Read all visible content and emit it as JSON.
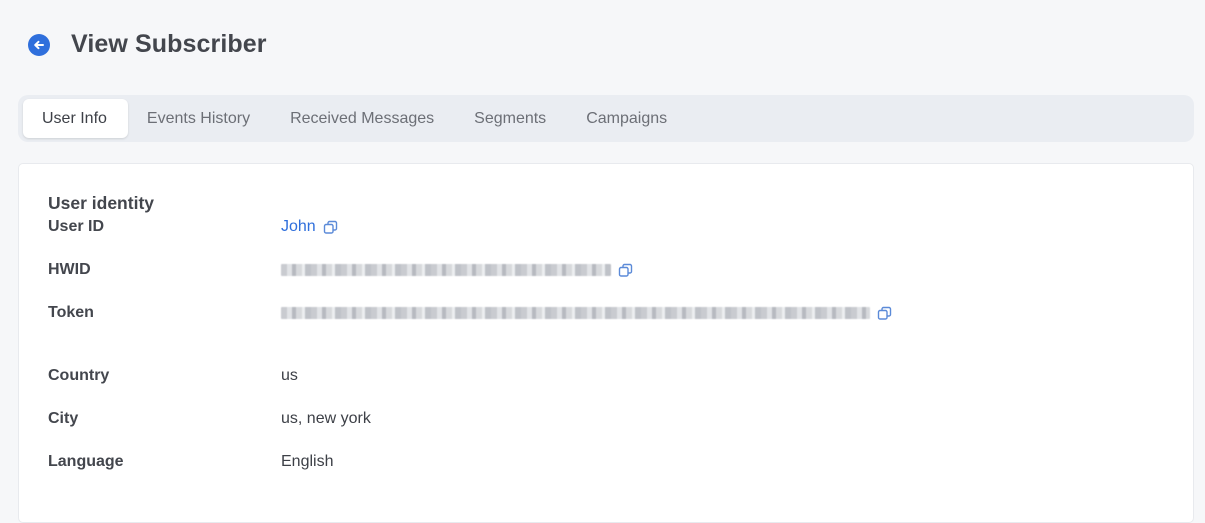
{
  "header": {
    "title": "View Subscriber",
    "back_icon": "arrow-left-circle-icon"
  },
  "tabs": [
    {
      "label": "User Info",
      "active": true
    },
    {
      "label": "Events History",
      "active": false
    },
    {
      "label": "Received Messages",
      "active": false
    },
    {
      "label": "Segments",
      "active": false
    },
    {
      "label": "Campaigns",
      "active": false
    }
  ],
  "user_identity": {
    "section_title": "User identity",
    "fields": [
      {
        "label": "User ID",
        "value": "John",
        "copyable": true
      },
      {
        "label": "HWID",
        "value": "[redacted]",
        "copyable": true
      },
      {
        "label": "Token",
        "value": "[redacted]",
        "copyable": true
      }
    ]
  },
  "location": {
    "fields": [
      {
        "label": "Country",
        "value": "us"
      },
      {
        "label": "City",
        "value": "us, new york"
      },
      {
        "label": "Language",
        "value": "English"
      }
    ]
  },
  "colors": {
    "accent": "#2f6fdc",
    "background": "#f6f7f9",
    "tabs_background": "#eaedf2"
  },
  "icons": {
    "copy": "copy-icon"
  }
}
